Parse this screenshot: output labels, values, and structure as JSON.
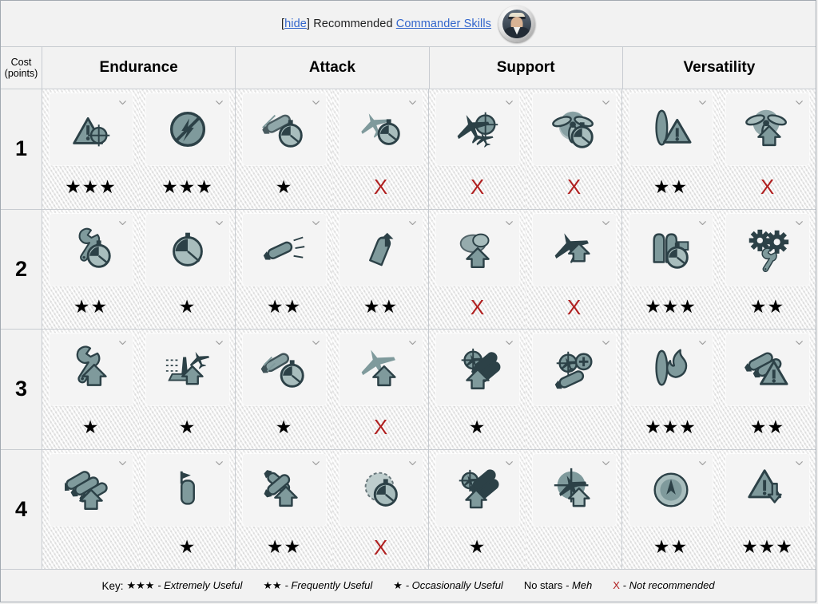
{
  "header": {
    "hide_open": "[",
    "hide_label": "hide",
    "hide_close": "]",
    "title_prefix": "Recommended",
    "title_link": "Commander Skills",
    "avatar_name": "commander-portrait",
    "link_color": "#3366cc"
  },
  "table": {
    "cost_header_line1": "Cost",
    "cost_header_line2": "(points)",
    "categories": [
      "Endurance",
      "Attack",
      "Support",
      "Versatility"
    ],
    "rows": [
      {
        "cost": "1",
        "cells": [
          {
            "icon": "warning-triangle-target-icon",
            "rating": "3",
            "rating_text": "★★★"
          },
          {
            "icon": "no-flooding-icon",
            "rating": "3",
            "rating_text": "★★★"
          },
          {
            "icon": "torpedo-stopwatch-icon",
            "rating": "1",
            "rating_text": "★"
          },
          {
            "icon": "aircraft-stopwatch-icon",
            "rating": "x",
            "rating_text": "X"
          },
          {
            "icon": "aircraft-target-icon",
            "rating": "x",
            "rating_text": "X"
          },
          {
            "icon": "propeller-stopwatch-icon",
            "rating": "x",
            "rating_text": "X"
          },
          {
            "icon": "torpedo-warning-icon",
            "rating": "2",
            "rating_text": "★★"
          },
          {
            "icon": "propeller-up-arrow-icon",
            "rating": "x",
            "rating_text": "X"
          }
        ]
      },
      {
        "cost": "2",
        "cells": [
          {
            "icon": "wrench-stopwatch-icon",
            "rating": "2",
            "rating_text": "★★"
          },
          {
            "icon": "stopwatch-icon",
            "rating": "1",
            "rating_text": "★"
          },
          {
            "icon": "torpedo-launch-icon",
            "rating": "2",
            "rating_text": "★★"
          },
          {
            "icon": "shell-up-arrow-icon",
            "rating": "2",
            "rating_text": "★★"
          },
          {
            "icon": "smoke-up-arrow-icon",
            "rating": "x",
            "rating_text": "X"
          },
          {
            "icon": "aircraft-up-arrow-icon",
            "rating": "x",
            "rating_text": "X"
          },
          {
            "icon": "shells-stopwatch-icon",
            "rating": "3",
            "rating_text": "★★★"
          },
          {
            "icon": "gears-wrench-icon",
            "rating": "2",
            "rating_text": "★★"
          }
        ]
      },
      {
        "cost": "3",
        "cells": [
          {
            "icon": "wrench-up-arrow-icon",
            "rating": "1",
            "rating_text": "★"
          },
          {
            "icon": "carrier-up-arrow-icon",
            "rating": "1",
            "rating_text": "★"
          },
          {
            "icon": "torpedo-stopwatch-alt-icon",
            "rating": "1",
            "rating_text": "★"
          },
          {
            "icon": "aircraft-up-arrow-alt-icon",
            "rating": "x",
            "rating_text": "X"
          },
          {
            "icon": "aircraft-shells-up-arrow-icon",
            "rating": "1",
            "rating_text": "★"
          },
          {
            "icon": "aircraft-plus-icon",
            "rating": "0",
            "rating_text": ""
          },
          {
            "icon": "torpedo-fire-icon",
            "rating": "3",
            "rating_text": "★★★"
          },
          {
            "icon": "torpedoes-warning-icon",
            "rating": "2",
            "rating_text": "★★"
          }
        ]
      },
      {
        "cost": "4",
        "cells": [
          {
            "icon": "shells-up-arrow-icon",
            "rating": "0",
            "rating_text": ""
          },
          {
            "icon": "flag-shell-icon",
            "rating": "1",
            "rating_text": "★"
          },
          {
            "icon": "crossed-torpedo-up-arrow-icon",
            "rating": "2",
            "rating_text": "★★"
          },
          {
            "icon": "radar-stopwatch-icon",
            "rating": "x",
            "rating_text": "X"
          },
          {
            "icon": "aircraft-shells-up-icon",
            "rating": "1",
            "rating_text": "★"
          },
          {
            "icon": "aircraft-radar-up-icon",
            "rating": "0",
            "rating_text": ""
          },
          {
            "icon": "compass-icon",
            "rating": "2",
            "rating_text": "★★"
          },
          {
            "icon": "warning-down-arrow-icon",
            "rating": "3",
            "rating_text": "★★★"
          }
        ]
      }
    ]
  },
  "key": {
    "label": "Key:",
    "items": [
      {
        "symbol": "★★★",
        "desc": "- Extremely Useful",
        "red": false,
        "italic": true
      },
      {
        "symbol": "★★",
        "desc": "- Frequently Useful",
        "red": false,
        "italic": true
      },
      {
        "symbol": "★",
        "desc": "- Occasionally Useful",
        "red": false,
        "italic": true
      },
      {
        "symbol": "No stars",
        "desc": "- Meh",
        "red": false,
        "italic": true
      },
      {
        "symbol": "X",
        "desc": "- Not recommended",
        "red": true,
        "italic": true
      }
    ]
  }
}
